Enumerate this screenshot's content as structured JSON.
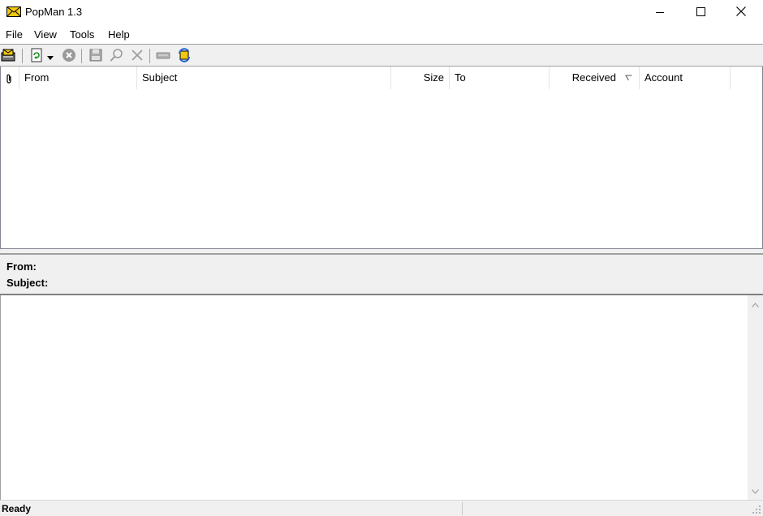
{
  "window": {
    "title": "PopMan 1.3",
    "controls": {
      "minimize": "minimize",
      "maximize": "maximize",
      "close": "close"
    }
  },
  "menu": {
    "items": [
      {
        "label": "File"
      },
      {
        "label": "View"
      },
      {
        "label": "Tools"
      },
      {
        "label": "Help"
      }
    ]
  },
  "toolbar": {
    "buttons": [
      {
        "icon": "mailbox-icon"
      },
      {
        "icon": "refresh-icon"
      },
      {
        "icon": "dropdown-arrow-icon"
      },
      {
        "icon": "stop-icon"
      },
      {
        "icon": "save-icon"
      },
      {
        "icon": "find-icon"
      },
      {
        "icon": "delete-icon"
      },
      {
        "icon": "keyboard-icon"
      },
      {
        "icon": "sync-icon"
      }
    ]
  },
  "message_list": {
    "columns": [
      {
        "label": "",
        "icon": "attachment-icon"
      },
      {
        "label": "From"
      },
      {
        "label": "Subject"
      },
      {
        "label": "Size"
      },
      {
        "label": "To"
      },
      {
        "label": "Received"
      },
      {
        "label": "Account"
      }
    ],
    "sort_indicator": "Received",
    "rows": []
  },
  "preview": {
    "from_label": "From:",
    "subject_label": "Subject:",
    "from_value": "",
    "subject_value": ""
  },
  "status": {
    "text": "Ready"
  },
  "colors": {
    "chrome": "#f0f0f0",
    "border": "#a0a0a0",
    "envelope": "#f2c811"
  }
}
